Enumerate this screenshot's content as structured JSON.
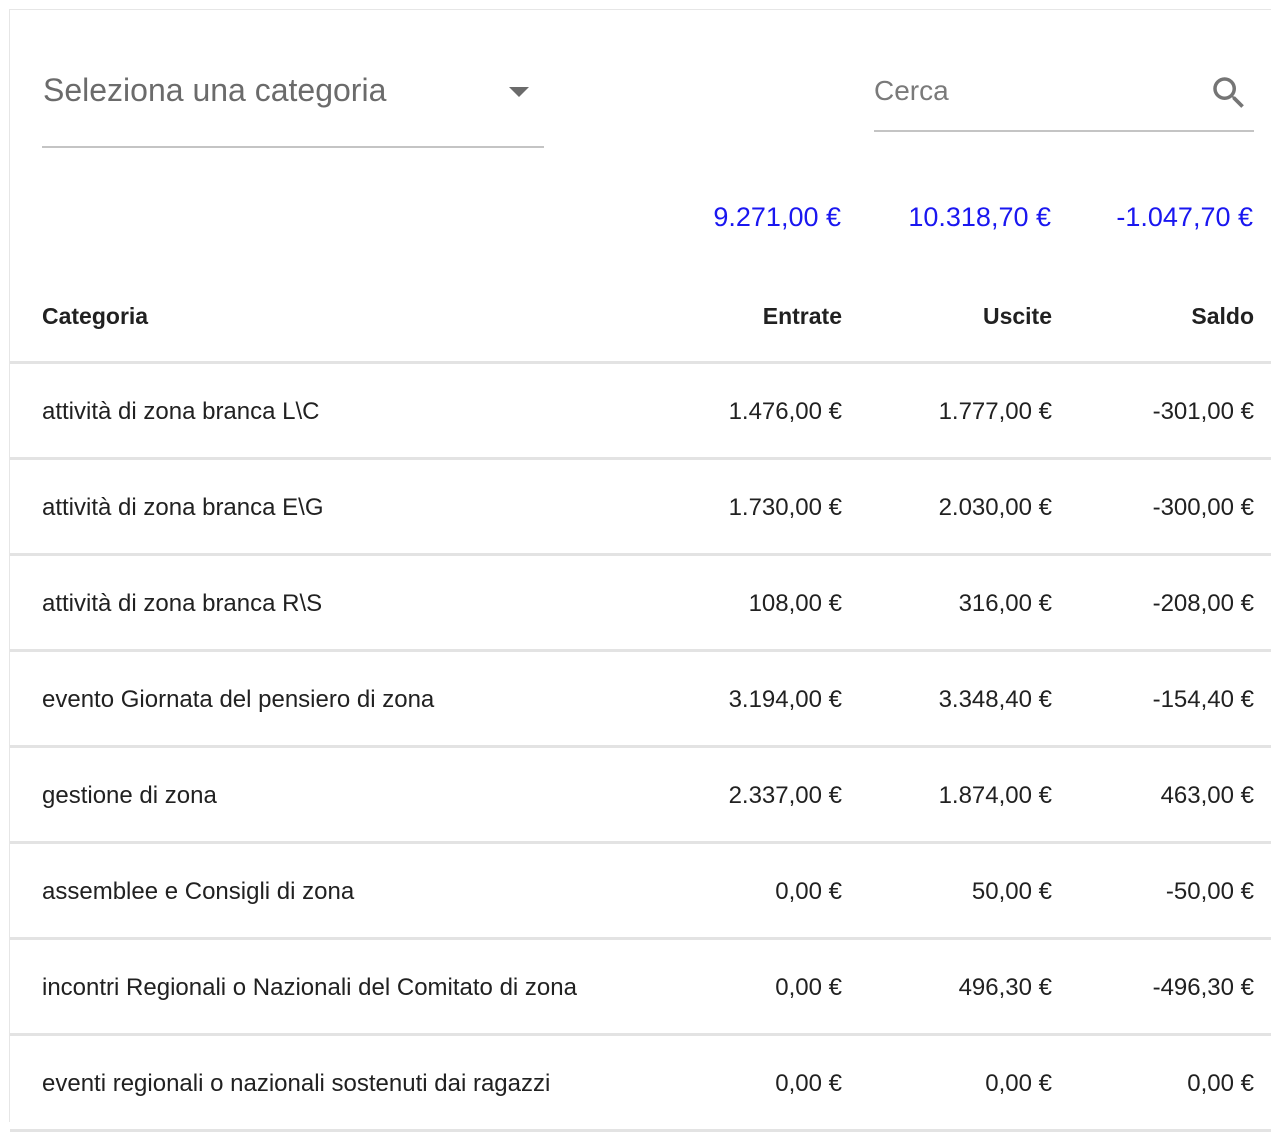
{
  "filters": {
    "category_placeholder": "Seleziona una categoria",
    "search_placeholder": "Cerca"
  },
  "totals": {
    "entrate": "9.271,00 €",
    "uscite": "10.318,70 €",
    "saldo": "-1.047,70 €"
  },
  "colors": {
    "totals": "#1a17f0"
  },
  "table": {
    "headers": {
      "categoria": "Categoria",
      "entrate": "Entrate",
      "uscite": "Uscite",
      "saldo": "Saldo"
    },
    "rows": [
      {
        "categoria": "attività di zona branca L\\C",
        "entrate": "1.476,00 €",
        "uscite": "1.777,00 €",
        "saldo": "-301,00 €"
      },
      {
        "categoria": "attività di zona branca E\\G",
        "entrate": "1.730,00 €",
        "uscite": "2.030,00 €",
        "saldo": "-300,00 €"
      },
      {
        "categoria": "attività di zona branca R\\S",
        "entrate": "108,00 €",
        "uscite": "316,00 €",
        "saldo": "-208,00 €"
      },
      {
        "categoria": "evento Giornata del pensiero di zona",
        "entrate": "3.194,00 €",
        "uscite": "3.348,40 €",
        "saldo": "-154,40 €"
      },
      {
        "categoria": "gestione di zona",
        "entrate": "2.337,00 €",
        "uscite": "1.874,00 €",
        "saldo": "463,00 €"
      },
      {
        "categoria": "assemblee e Consigli di zona",
        "entrate": "0,00 €",
        "uscite": "50,00 €",
        "saldo": "-50,00 €"
      },
      {
        "categoria": "incontri Regionali o Nazionali del Comitato di zona",
        "entrate": "0,00 €",
        "uscite": "496,30 €",
        "saldo": "-496,30 €"
      },
      {
        "categoria": "eventi regionali o nazionali sostenuti dai ragazzi",
        "entrate": "0,00 €",
        "uscite": "0,00 €",
        "saldo": "0,00 €"
      }
    ]
  }
}
